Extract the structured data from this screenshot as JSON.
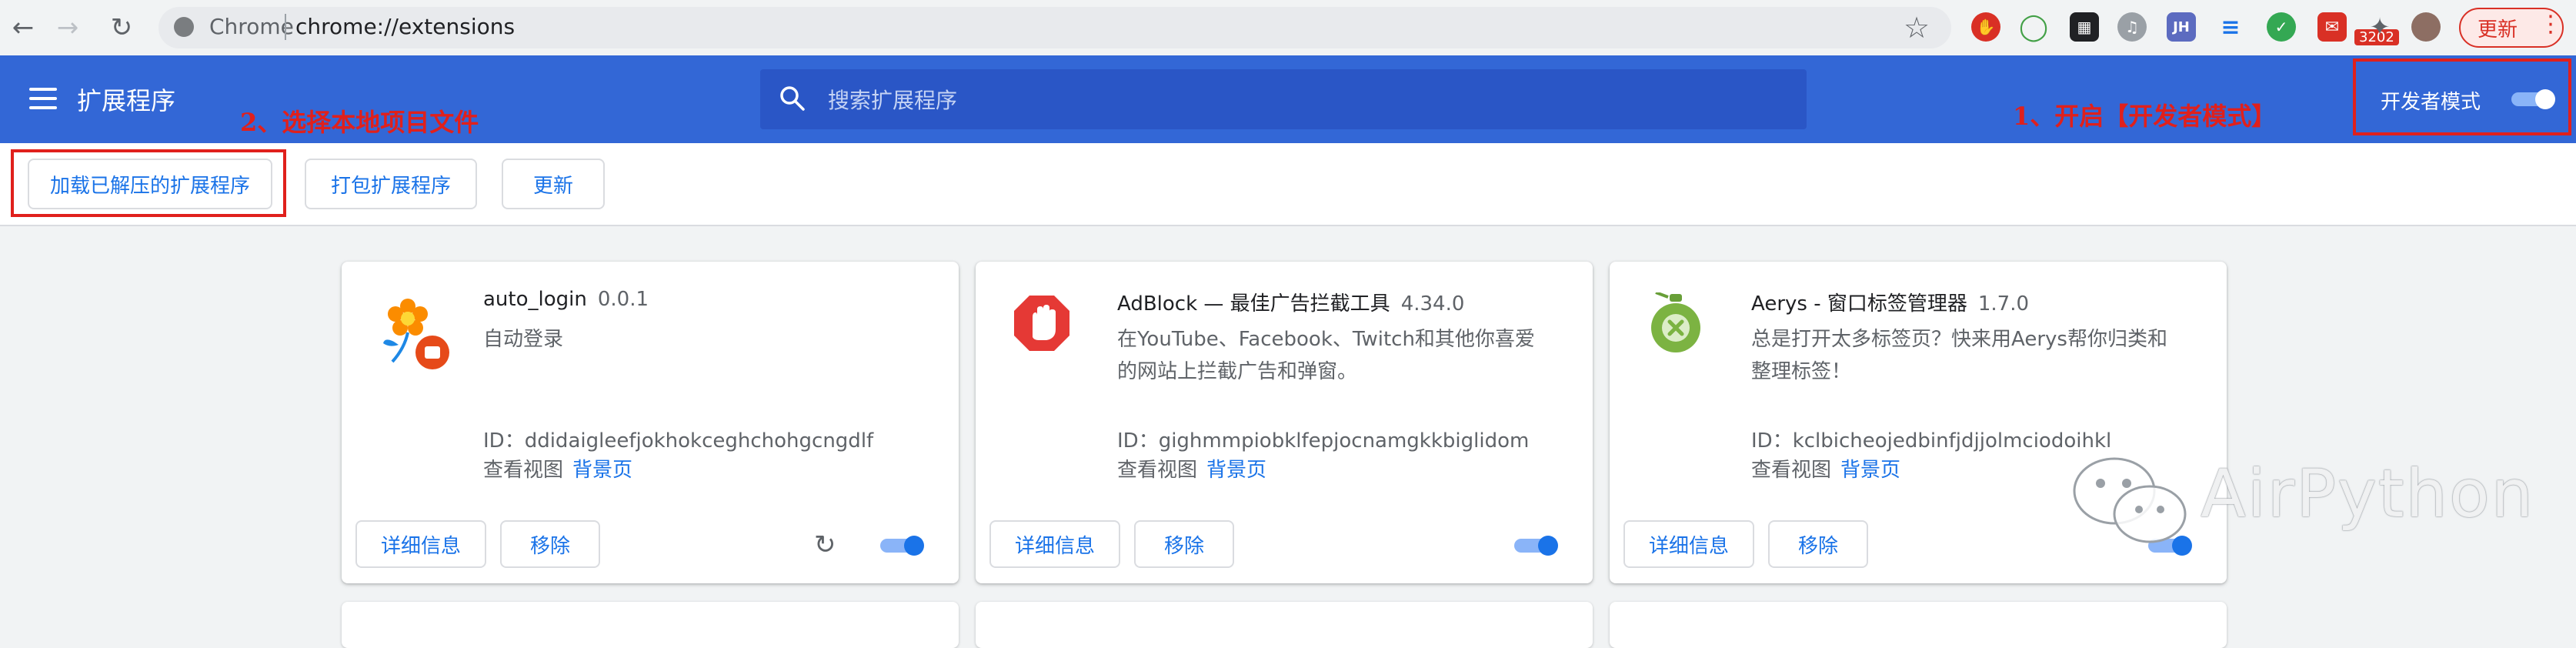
{
  "browser": {
    "omnibox_label": "Chrome",
    "url": "chrome://extensions",
    "badge_count": "3202",
    "extension_icon_jh": "JH",
    "update_label": "更新"
  },
  "header": {
    "title": "扩展程序",
    "search_placeholder": "搜索扩展程序",
    "dev_mode_label": "开发者模式",
    "dev_mode_on": true
  },
  "toolbar": {
    "load_unpacked": "加载已解压的扩展程序",
    "pack": "打包扩展程序",
    "update": "更新"
  },
  "annotations": {
    "step1": "1、开启【开发者模式】",
    "step2": "2、选择本地项目文件"
  },
  "extensions": [
    {
      "name": "auto_login",
      "version": "0.0.1",
      "description": "自动登录",
      "id_label": "ID：",
      "id": "ddidaigleefjokhokceghchohgcngdlf",
      "views_label": "查看视图",
      "views_link": "背景页",
      "details_label": "详细信息",
      "remove_label": "移除",
      "enabled": true,
      "icon": "flower-icon"
    },
    {
      "name": "AdBlock — 最佳广告拦截工具",
      "version": "4.34.0",
      "description": "在YouTube、Facebook、Twitch和其他你喜爱的网站上拦截广告和弹窗。",
      "id_label": "ID：",
      "id": "gighmmpiobklfepjocnamgkkbiglidom",
      "views_label": "查看视图",
      "views_link": "背景页",
      "details_label": "详细信息",
      "remove_label": "移除",
      "enabled": true,
      "icon": "adblock-hand-icon"
    },
    {
      "name": "Aerys - 窗口标签管理器",
      "version": "1.7.0",
      "description": "总是打开太多标签页？快来用Aerys帮你归类和整理标签！",
      "id_label": "ID：",
      "id": "kclbicheojedbinfjdjjolmciodoihkl",
      "views_label": "查看视图",
      "views_link": "背景页",
      "details_label": "详细信息",
      "remove_label": "移除",
      "enabled": true,
      "icon": "green-potion-icon"
    }
  ],
  "watermark": "AirPython",
  "colors": {
    "header_blue": "#3367d6",
    "accent_blue": "#1a73e8",
    "annotation_red": "#e0201c"
  }
}
